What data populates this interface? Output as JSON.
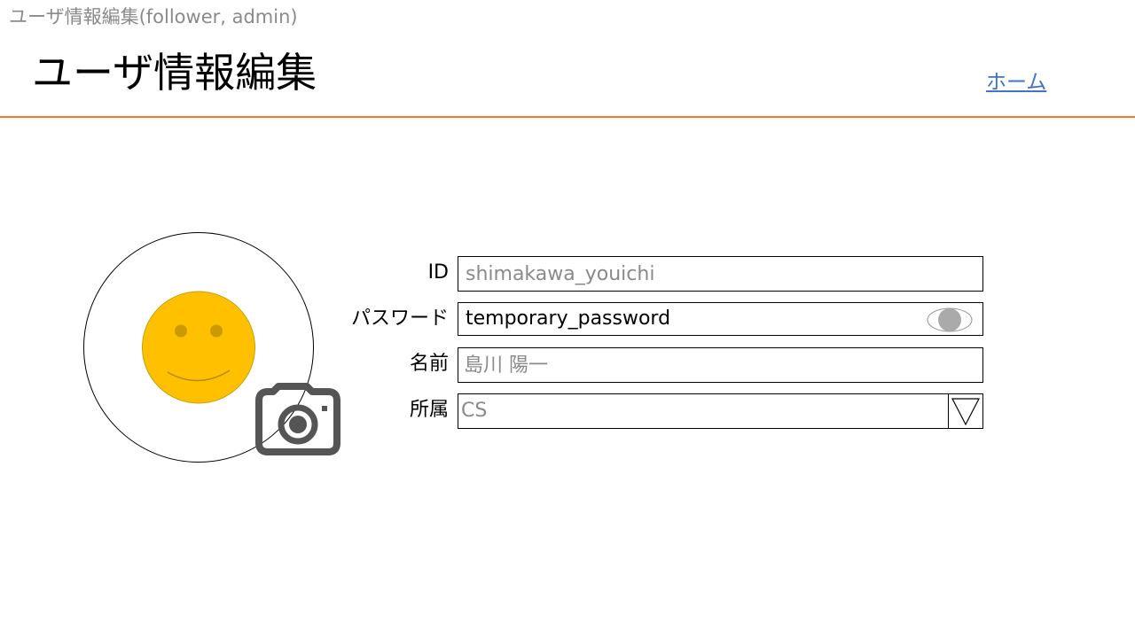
{
  "caption": "ユーザ情報編集(follower, admin)",
  "header": {
    "title": "ユーザ情報編集",
    "home_link": "ホーム",
    "accent_color": "#ed7d31",
    "link_color": "#4472c4"
  },
  "avatar": {
    "face_icon": "smiley-face-icon",
    "face_color": "#ffc000",
    "upload_icon": "camera-icon"
  },
  "form": {
    "id": {
      "label": "ID",
      "placeholder": "shimakawa_youichi"
    },
    "password": {
      "label": "パスワード",
      "value": "temporary_password",
      "toggle_icon": "eye-icon"
    },
    "name": {
      "label": "名前",
      "placeholder": "島川 陽一"
    },
    "affiliation": {
      "label": "所属",
      "selected": "CS",
      "dropdown_icon": "triangle-down-icon"
    }
  }
}
